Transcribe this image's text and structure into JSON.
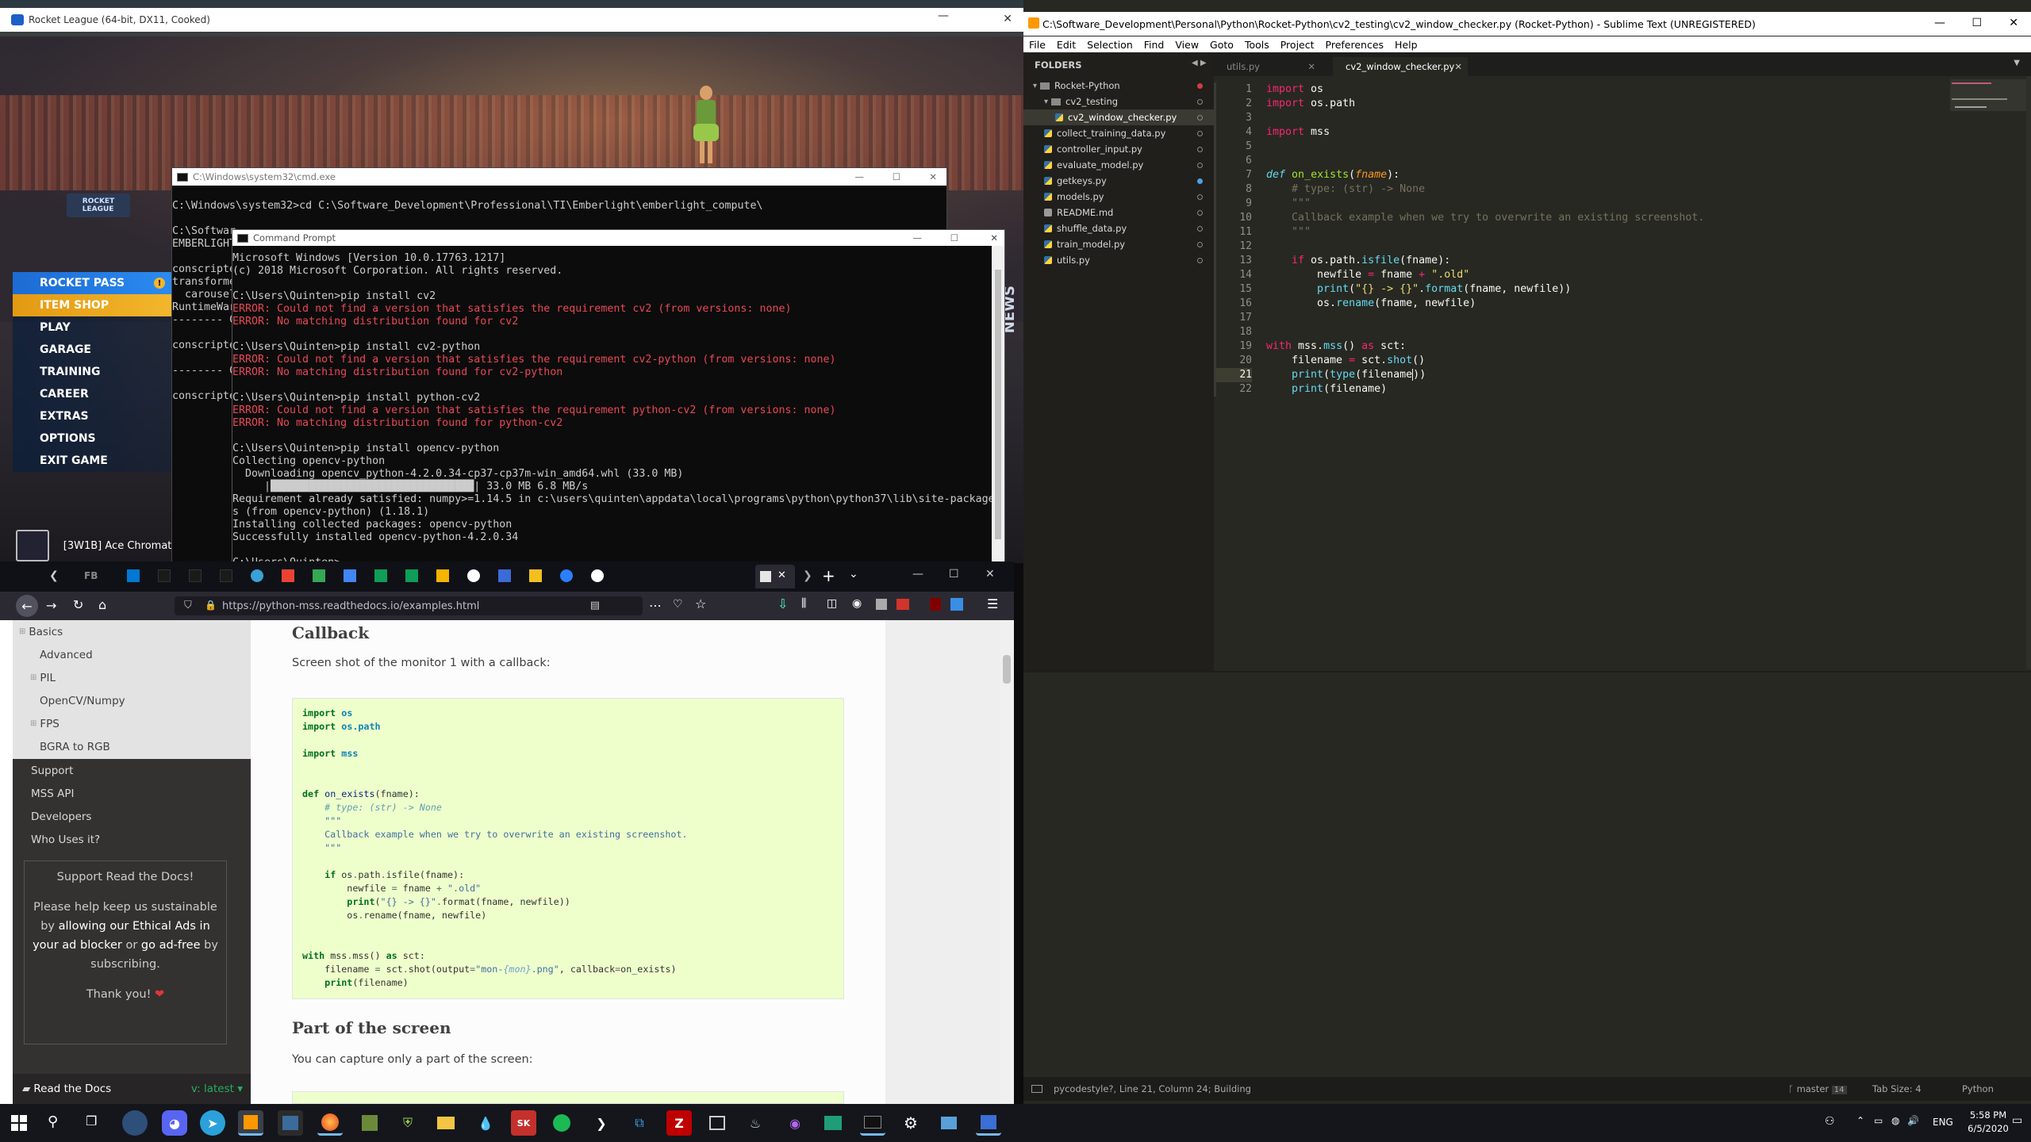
{
  "rocket_league": {
    "title": "Rocket League (64-bit, DX11, Cooked)",
    "menu": [
      "ROCKET PASS",
      "ITEM SHOP",
      "PLAY",
      "GARAGE",
      "TRAINING",
      "CAREER",
      "EXTRAS",
      "OPTIONS",
      "EXIT GAME"
    ],
    "player": "[3W1B] Ace Chromati",
    "news_label": "NEWS"
  },
  "cmd1": {
    "title": "C:\\Windows\\system32\\cmd.exe",
    "lines": [
      "C:\\Windows\\system32>cd C:\\Software_Development\\Professional\\TI\\Emberlight\\emberlight_compute\\",
      "",
      "C:\\Softwar",
      "EMBERLIGHT",
      "",
      "conscripte",
      "transforme",
      "  carousel",
      "RuntimeWar",
      "-------- C",
      "",
      "conscripte",
      "",
      "-------- C",
      "",
      "conscripte"
    ]
  },
  "cmd2": {
    "title": "Command Prompt",
    "lines": [
      {
        "t": "Microsoft Windows [Version 10.0.17763.1217]",
        "e": false
      },
      {
        "t": "(c) 2018 Microsoft Corporation. All rights reserved.",
        "e": false
      },
      {
        "t": "",
        "e": false
      },
      {
        "t": "C:\\Users\\Quinten>pip install cv2",
        "e": false
      },
      {
        "t": "ERROR: Could not find a version that satisfies the requirement cv2 (from versions: none)",
        "e": true
      },
      {
        "t": "ERROR: No matching distribution found for cv2",
        "e": true
      },
      {
        "t": "",
        "e": false
      },
      {
        "t": "C:\\Users\\Quinten>pip install cv2-python",
        "e": false
      },
      {
        "t": "ERROR: Could not find a version that satisfies the requirement cv2-python (from versions: none)",
        "e": true
      },
      {
        "t": "ERROR: No matching distribution found for cv2-python",
        "e": true
      },
      {
        "t": "",
        "e": false
      },
      {
        "t": "C:\\Users\\Quinten>pip install python-cv2",
        "e": false
      },
      {
        "t": "ERROR: Could not find a version that satisfies the requirement python-cv2 (from versions: none)",
        "e": true
      },
      {
        "t": "ERROR: No matching distribution found for python-cv2",
        "e": true
      },
      {
        "t": "",
        "e": false
      },
      {
        "t": "C:\\Users\\Quinten>pip install opencv-python",
        "e": false
      },
      {
        "t": "Collecting opencv-python",
        "e": false
      },
      {
        "t": "  Downloading opencv_python-4.2.0.34-cp37-cp37m-win_amd64.whl (33.0 MB)",
        "e": false
      },
      {
        "t": "     |████████████████████████████████| 33.0 MB 6.8 MB/s",
        "e": false
      },
      {
        "t": "Requirement already satisfied: numpy>=1.14.5 in c:\\users\\quinten\\appdata\\local\\programs\\python\\python37\\lib\\site-package",
        "e": false
      },
      {
        "t": "s (from opencv-python) (1.18.1)",
        "e": false
      },
      {
        "t": "Installing collected packages: opencv-python",
        "e": false
      },
      {
        "t": "Successfully installed opencv-python-4.2.0.34",
        "e": false
      },
      {
        "t": "",
        "e": false
      },
      {
        "t": "C:\\Users\\Quinten>",
        "e": false
      }
    ]
  },
  "sublime": {
    "title": "C:\\Software_Development\\Personal\\Python\\Rocket-Python\\cv2_testing\\cv2_window_checker.py (Rocket-Python) - Sublime Text (UNREGISTERED)",
    "menu": [
      "File",
      "Edit",
      "Selection",
      "Find",
      "View",
      "Goto",
      "Tools",
      "Project",
      "Preferences",
      "Help"
    ],
    "folders_label": "FOLDERS",
    "tree": [
      {
        "name": "Rocket-Python",
        "level": 0,
        "type": "folder"
      },
      {
        "name": "cv2_testing",
        "level": 1,
        "type": "folder"
      },
      {
        "name": "cv2_window_checker.py",
        "level": 2,
        "type": "file",
        "active": true
      },
      {
        "name": "collect_training_data.py",
        "level": 1,
        "type": "file"
      },
      {
        "name": "controller_input.py",
        "level": 1,
        "type": "file"
      },
      {
        "name": "evaluate_model.py",
        "level": 1,
        "type": "file"
      },
      {
        "name": "getkeys.py",
        "level": 1,
        "type": "file"
      },
      {
        "name": "models.py",
        "level": 1,
        "type": "file"
      },
      {
        "name": "README.md",
        "level": 1,
        "type": "md"
      },
      {
        "name": "shuffle_data.py",
        "level": 1,
        "type": "file"
      },
      {
        "name": "train_model.py",
        "level": 1,
        "type": "file"
      },
      {
        "name": "utils.py",
        "level": 1,
        "type": "file"
      }
    ],
    "tabs": [
      "utils.py",
      "cv2_window_checker.py"
    ],
    "line_numbers": [
      "1",
      "2",
      "3",
      "4",
      "5",
      "6",
      "7",
      "8",
      "9",
      "10",
      "11",
      "12",
      "13",
      "14",
      "15",
      "16",
      "17",
      "18",
      "19",
      "20",
      "21",
      "22"
    ],
    "status_left": "pycodestyle?, Line 21, Column 24; Building",
    "status_branch": "master",
    "status_branch_count": "14",
    "status_tab": "Tab Size: 4",
    "status_syntax": "Python"
  },
  "firefox": {
    "url": "https://python-mss.readthedocs.io/examples.html",
    "sidebar": [
      "Basics",
      "Advanced",
      "PIL",
      "OpenCV/Numpy",
      "FPS",
      "BGRA to RGB",
      "Support",
      "MSS API",
      "Developers",
      "Who Uses it?"
    ],
    "support_title": "Support Read the Docs!",
    "support_body_1": "Please help keep us sustainable by",
    "support_link_1": "allowing our Ethical Ads in your ad blocker",
    "support_or": "or",
    "support_link_2": "go ad-free",
    "support_body_2": "by subscribing.",
    "support_thanks": "Thank you!",
    "rtd_footer": "Read the Docs",
    "rtd_version": "v: latest",
    "section_callback": "Callback",
    "callback_desc": "Screen shot of the monitor 1 with a callback:",
    "section_part": "Part of the screen",
    "part_desc": "You can capture only a part of the screen:"
  },
  "taskbar": {
    "time": "5:58 PM",
    "date": "6/5/2020",
    "lang": "ENG"
  }
}
